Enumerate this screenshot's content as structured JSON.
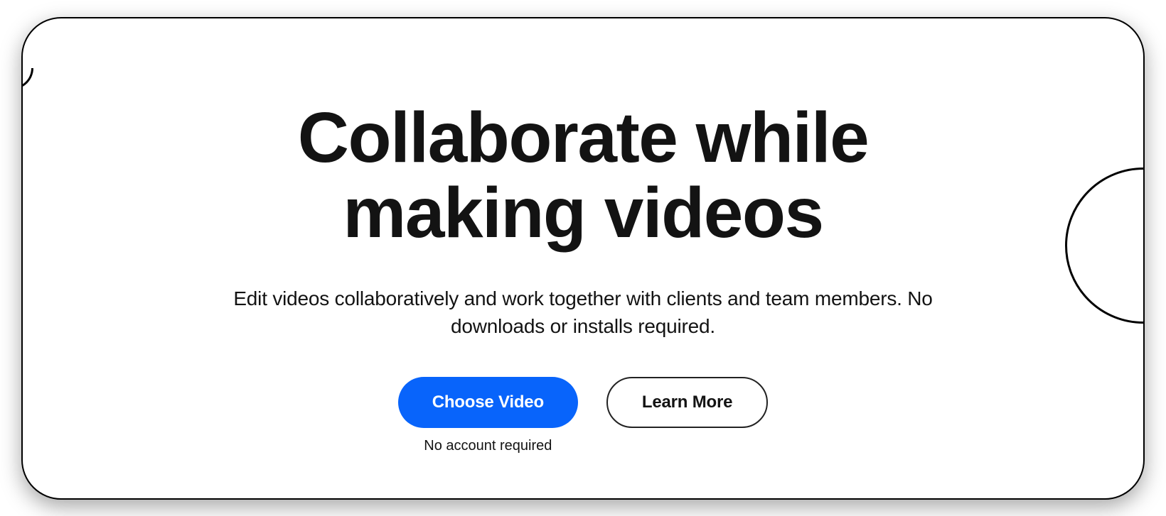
{
  "hero": {
    "headline": "Collaborate while making videos",
    "subheadline": "Edit videos collaboratively and work together with clients and team members. No downloads or installs required.",
    "cta": {
      "primary": {
        "label": "Choose Video",
        "hint": "No account required"
      },
      "secondary": {
        "label": "Learn More"
      }
    }
  },
  "colors": {
    "primary": "#0864fb",
    "text": "#131313",
    "border": "#000000",
    "background": "#ffffff"
  }
}
